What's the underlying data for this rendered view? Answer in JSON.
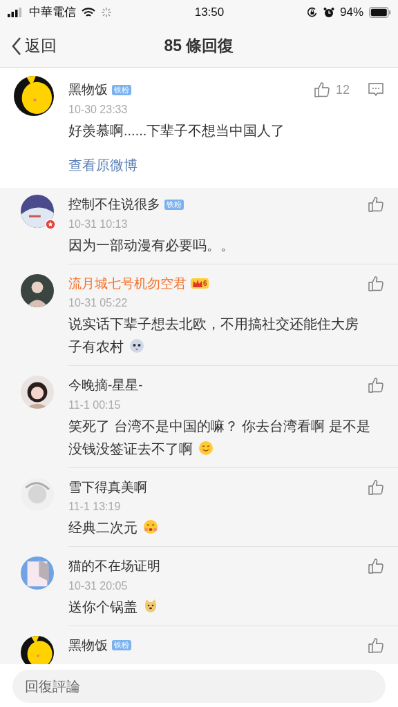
{
  "status_bar": {
    "carrier": "中華電信",
    "time": "13:50",
    "battery": "94%"
  },
  "nav": {
    "back": "返回",
    "title": "85 條回復"
  },
  "post": {
    "name": "黑物饭",
    "badge": "铁粉",
    "likes": "12",
    "date": "10-30 23:33",
    "text": "好羡慕啊......下辈子不想当中国人了",
    "link": "查看原微博"
  },
  "replies": [
    {
      "verified": true,
      "name": "控制不住说很多",
      "name_highlighted": false,
      "badge": "铁粉",
      "date": "10-31 10:13",
      "text": "因为一部动漫有必要吗。。"
    },
    {
      "verified": false,
      "name": "流月城七号机勿空君",
      "name_highlighted": true,
      "vip_level": "6",
      "date": "10-31 05:22",
      "text": "说实话下辈子想去北欧，不用搞社交还能住大房子有农村",
      "emoji": true
    },
    {
      "verified": false,
      "name": "今晚摘-星星-",
      "name_highlighted": false,
      "date": "11-1 00:15",
      "text": "笑死了 台湾不是中国的嘛？ 你去台湾看啊 是不是没钱没签证去不了啊",
      "emoji": true
    },
    {
      "verified": false,
      "name": "雪下得真美啊",
      "name_highlighted": false,
      "date": "11-1 13:19",
      "text": "经典二次元",
      "emoji": true
    },
    {
      "verified": false,
      "name": "猫的不在场证明",
      "name_highlighted": false,
      "date": "10-31 20:05",
      "text": "送你个锅盖",
      "emoji": true
    },
    {
      "verified": false,
      "name": "黑物饭",
      "name_highlighted": false,
      "badge": "铁粉"
    }
  ],
  "reply_bar": {
    "placeholder": "回復評論"
  }
}
